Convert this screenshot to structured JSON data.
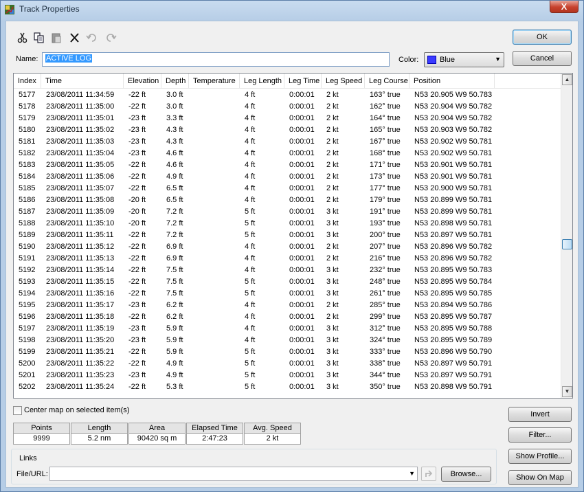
{
  "window": {
    "title": "Track Properties",
    "close_glyph": "X"
  },
  "toolbar": {
    "icons": [
      "cut-icon",
      "copy-icon",
      "paste-icon",
      "delete-icon",
      "undo-icon",
      "redo-icon"
    ]
  },
  "name": {
    "label": "Name:",
    "value": "ACTIVE LOG"
  },
  "color": {
    "label": "Color:",
    "value": "Blue",
    "swatch": "#3a3aff"
  },
  "buttons": {
    "ok": "OK",
    "cancel": "Cancel",
    "invert": "Invert",
    "filter": "Filter...",
    "show_profile": "Show Profile...",
    "show_on_map": "Show On Map",
    "browse": "Browse..."
  },
  "table": {
    "columns": [
      "Index",
      "Time",
      "Elevation",
      "Depth",
      "Temperature",
      "Leg Length",
      "Leg Time",
      "Leg Speed",
      "Leg Course",
      "Position"
    ],
    "rows": [
      [
        "5177",
        "23/08/2011 11:34:59",
        "-22 ft",
        "3.0 ft",
        "",
        "4 ft",
        "0:00:01",
        "2 kt",
        "163° true",
        "N53 20.905 W9 50.783"
      ],
      [
        "5178",
        "23/08/2011 11:35:00",
        "-22 ft",
        "3.0 ft",
        "",
        "4 ft",
        "0:00:01",
        "2 kt",
        "162° true",
        "N53 20.904 W9 50.782"
      ],
      [
        "5179",
        "23/08/2011 11:35:01",
        "-23 ft",
        "3.3 ft",
        "",
        "4 ft",
        "0:00:01",
        "2 kt",
        "164° true",
        "N53 20.904 W9 50.782"
      ],
      [
        "5180",
        "23/08/2011 11:35:02",
        "-23 ft",
        "4.3 ft",
        "",
        "4 ft",
        "0:00:01",
        "2 kt",
        "165° true",
        "N53 20.903 W9 50.782"
      ],
      [
        "5181",
        "23/08/2011 11:35:03",
        "-23 ft",
        "4.3 ft",
        "",
        "4 ft",
        "0:00:01",
        "2 kt",
        "167° true",
        "N53 20.902 W9 50.781"
      ],
      [
        "5182",
        "23/08/2011 11:35:04",
        "-23 ft",
        "4.6 ft",
        "",
        "4 ft",
        "0:00:01",
        "2 kt",
        "168° true",
        "N53 20.902 W9 50.781"
      ],
      [
        "5183",
        "23/08/2011 11:35:05",
        "-22 ft",
        "4.6 ft",
        "",
        "4 ft",
        "0:00:01",
        "2 kt",
        "171° true",
        "N53 20.901 W9 50.781"
      ],
      [
        "5184",
        "23/08/2011 11:35:06",
        "-22 ft",
        "4.9 ft",
        "",
        "4 ft",
        "0:00:01",
        "2 kt",
        "173° true",
        "N53 20.901 W9 50.781"
      ],
      [
        "5185",
        "23/08/2011 11:35:07",
        "-22 ft",
        "6.5 ft",
        "",
        "4 ft",
        "0:00:01",
        "2 kt",
        "177° true",
        "N53 20.900 W9 50.781"
      ],
      [
        "5186",
        "23/08/2011 11:35:08",
        "-20 ft",
        "6.5 ft",
        "",
        "4 ft",
        "0:00:01",
        "2 kt",
        "179° true",
        "N53 20.899 W9 50.781"
      ],
      [
        "5187",
        "23/08/2011 11:35:09",
        "-20 ft",
        "7.2 ft",
        "",
        "5 ft",
        "0:00:01",
        "3 kt",
        "191° true",
        "N53 20.899 W9 50.781"
      ],
      [
        "5188",
        "23/08/2011 11:35:10",
        "-20 ft",
        "7.2 ft",
        "",
        "5 ft",
        "0:00:01",
        "3 kt",
        "193° true",
        "N53 20.898 W9 50.781"
      ],
      [
        "5189",
        "23/08/2011 11:35:11",
        "-22 ft",
        "7.2 ft",
        "",
        "5 ft",
        "0:00:01",
        "3 kt",
        "200° true",
        "N53 20.897 W9 50.781"
      ],
      [
        "5190",
        "23/08/2011 11:35:12",
        "-22 ft",
        "6.9 ft",
        "",
        "4 ft",
        "0:00:01",
        "2 kt",
        "207° true",
        "N53 20.896 W9 50.782"
      ],
      [
        "5191",
        "23/08/2011 11:35:13",
        "-22 ft",
        "6.9 ft",
        "",
        "4 ft",
        "0:00:01",
        "2 kt",
        "216° true",
        "N53 20.896 W9 50.782"
      ],
      [
        "5192",
        "23/08/2011 11:35:14",
        "-22 ft",
        "7.5 ft",
        "",
        "4 ft",
        "0:00:01",
        "3 kt",
        "232° true",
        "N53 20.895 W9 50.783"
      ],
      [
        "5193",
        "23/08/2011 11:35:15",
        "-22 ft",
        "7.5 ft",
        "",
        "5 ft",
        "0:00:01",
        "3 kt",
        "248° true",
        "N53 20.895 W9 50.784"
      ],
      [
        "5194",
        "23/08/2011 11:35:16",
        "-22 ft",
        "7.5 ft",
        "",
        "5 ft",
        "0:00:01",
        "3 kt",
        "261° true",
        "N53 20.895 W9 50.785"
      ],
      [
        "5195",
        "23/08/2011 11:35:17",
        "-23 ft",
        "6.2 ft",
        "",
        "4 ft",
        "0:00:01",
        "2 kt",
        "285° true",
        "N53 20.894 W9 50.786"
      ],
      [
        "5196",
        "23/08/2011 11:35:18",
        "-22 ft",
        "6.2 ft",
        "",
        "4 ft",
        "0:00:01",
        "2 kt",
        "299° true",
        "N53 20.895 W9 50.787"
      ],
      [
        "5197",
        "23/08/2011 11:35:19",
        "-23 ft",
        "5.9 ft",
        "",
        "4 ft",
        "0:00:01",
        "3 kt",
        "312° true",
        "N53 20.895 W9 50.788"
      ],
      [
        "5198",
        "23/08/2011 11:35:20",
        "-23 ft",
        "5.9 ft",
        "",
        "4 ft",
        "0:00:01",
        "3 kt",
        "324° true",
        "N53 20.895 W9 50.789"
      ],
      [
        "5199",
        "23/08/2011 11:35:21",
        "-22 ft",
        "5.9 ft",
        "",
        "5 ft",
        "0:00:01",
        "3 kt",
        "333° true",
        "N53 20.896 W9 50.790"
      ],
      [
        "5200",
        "23/08/2011 11:35:22",
        "-22 ft",
        "4.9 ft",
        "",
        "5 ft",
        "0:00:01",
        "3 kt",
        "338° true",
        "N53 20.897 W9 50.791"
      ],
      [
        "5201",
        "23/08/2011 11:35:23",
        "-23 ft",
        "4.9 ft",
        "",
        "5 ft",
        "0:00:01",
        "3 kt",
        "344° true",
        "N53 20.897 W9 50.791"
      ],
      [
        "5202",
        "23/08/2011 11:35:24",
        "-22 ft",
        "5.3 ft",
        "",
        "5 ft",
        "0:00:01",
        "3 kt",
        "350° true",
        "N53 20.898 W9 50.791"
      ]
    ]
  },
  "center_map": {
    "label": "Center map on selected item(s)",
    "checked": false
  },
  "stats": {
    "headers": [
      "Points",
      "Length",
      "Area",
      "Elapsed Time",
      "Avg. Speed"
    ],
    "values": [
      "9999",
      "5.2 nm",
      "90420 sq m",
      "2:47:23",
      "2 kt"
    ]
  },
  "links": {
    "group_label": "Links",
    "file_url_label": "File/URL:",
    "value": ""
  },
  "scroll": {
    "position_fraction": 0.53
  }
}
